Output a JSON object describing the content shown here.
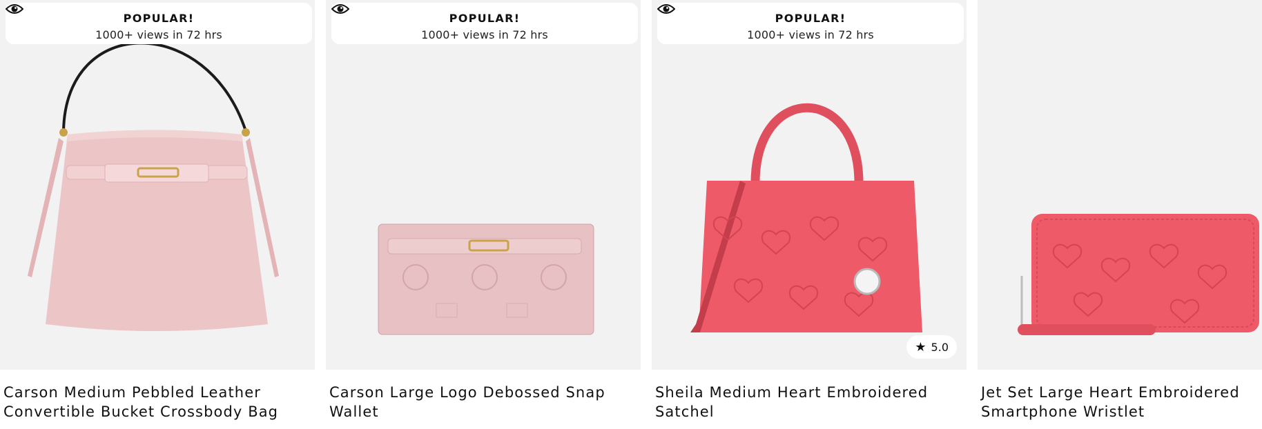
{
  "products": [
    {
      "name": "Carson Medium Pebbled Leather Convertible Bucket Crossbody Bag",
      "badge": {
        "icon": "eye-icon",
        "title": "POPULAR!",
        "subtitle": "1000+ views in 72 hrs"
      },
      "color": "#ecc5c7"
    },
    {
      "name": "Carson Large Logo Debossed Snap Wallet",
      "badge": {
        "icon": "eye-icon",
        "title": "POPULAR!",
        "subtitle": "1000+ views in 72 hrs"
      },
      "color": "#e7c1c3"
    },
    {
      "name": "Sheila Medium Heart Embroidered Satchel",
      "badge": {
        "icon": "eye-icon",
        "title": "POPULAR!",
        "subtitle": "1000+ views in 72 hrs"
      },
      "rating": {
        "icon": "star-icon",
        "value": "5.0"
      },
      "color": "#ee5a67"
    },
    {
      "name": "Jet Set Large Heart Embroidered Smartphone Wristlet",
      "color": "#ee5a67"
    }
  ]
}
